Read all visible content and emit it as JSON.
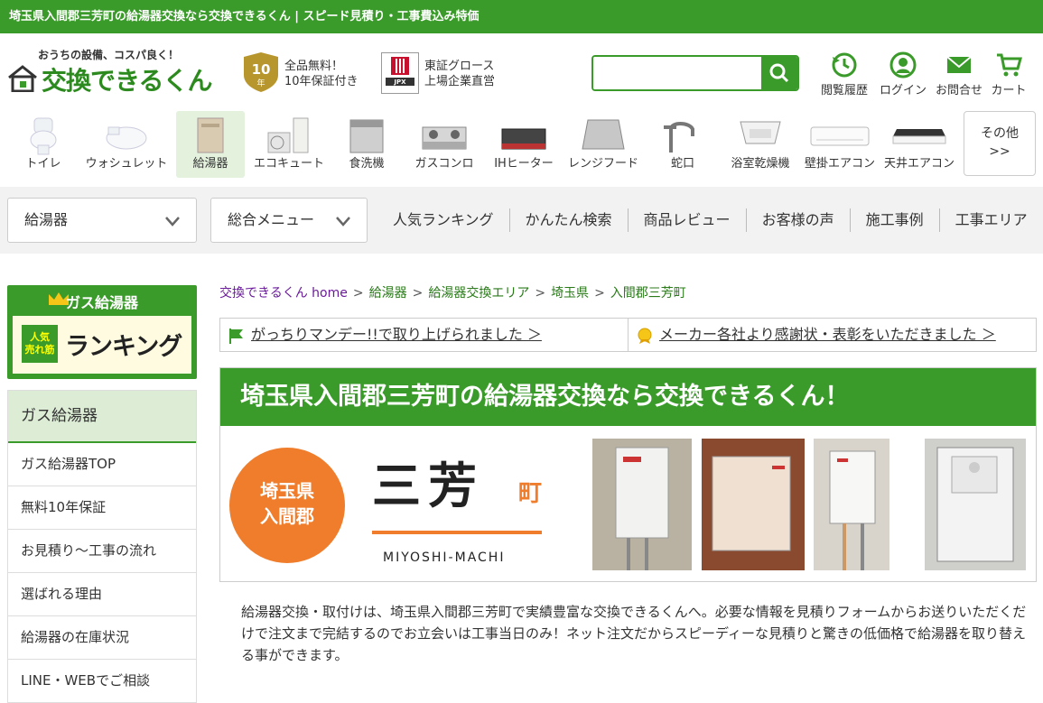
{
  "topbar": {
    "text": "埼玉県入間郡三芳町の給湯器交換なら交換できるくん | スピード見積り・工事費込み特価"
  },
  "header": {
    "logo_tagline": "おうちの設備、コスパ良く！",
    "logo_name": "交換できるくん",
    "badge_line1": "全品無料！",
    "badge_line2": "10年保証付き",
    "jpx_line1": "東証グロース",
    "jpx_line2": "上場企業直営",
    "search_value": "",
    "icons": [
      {
        "label": "閲覧履歴",
        "icon": "history-icon"
      },
      {
        "label": "ログイン",
        "icon": "user-icon"
      },
      {
        "label": "お問合せ",
        "icon": "mail-icon"
      },
      {
        "label": "カート",
        "icon": "cart-icon"
      }
    ]
  },
  "categories": [
    {
      "label": "トイレ"
    },
    {
      "label": "ウォシュレット"
    },
    {
      "label": "給湯器"
    },
    {
      "label": "エコキュート"
    },
    {
      "label": "食洗機"
    },
    {
      "label": "ガスコンロ"
    },
    {
      "label": "IHヒーター"
    },
    {
      "label": "レンジフード"
    },
    {
      "label": "蛇口"
    },
    {
      "label": "浴室乾燥機"
    },
    {
      "label": "壁掛エアコン"
    },
    {
      "label": "天井エアコン"
    }
  ],
  "category_more": {
    "line1": "その他",
    "line2": ">>"
  },
  "nav": {
    "dropdown1": "給湯器",
    "dropdown2": "総合メニュー",
    "links": [
      "人気ランキング",
      "かんたん検索",
      "商品レビュー",
      "お客様の声",
      "施工事例",
      "工事エリア"
    ]
  },
  "sidebar": {
    "rank_title": "ガス給湯器",
    "rank_sub1": "人気",
    "rank_sub2": "売れ筋",
    "rank_big": "ランキング",
    "menu_head": "ガス給湯器",
    "menu_items": [
      "ガス給湯器TOP",
      "無料10年保証",
      "お見積り～工事の流れ",
      "選ばれる理由",
      "給湯器の在庫状況",
      "LINE・WEBでご相談"
    ]
  },
  "breadcrumb": [
    "交換できるくん home",
    "給湯器",
    "給湯器交換エリア",
    "埼玉県",
    "入間郡三芳町"
  ],
  "notices": [
    "がっちりマンデー!!で取り上げられました ＞",
    "メーカー各社より感謝状・表彰をいただきました ＞"
  ],
  "hero": {
    "title": "埼玉県入間郡三芳町の給湯器交換なら交換できるくん！",
    "pref1": "埼玉県",
    "pref2": "入間郡",
    "town": "三芳",
    "town_suffix": "町",
    "romaji": "MIYOSHI-MACHI"
  },
  "description": "給湯器交換・取付けは、埼玉県入間郡三芳町で実績豊富な交換できるくんへ。必要な情報を見積りフォームからお送りいただくだけで注文まで完結するのでお立会いは工事当日のみ！ネット注文だからスピーディーな見積りと驚きの低価格で給湯器を取り替える事ができます。",
  "colors": {
    "brand_green": "#3a9a2a",
    "accent_orange": "#ef7d2b"
  }
}
